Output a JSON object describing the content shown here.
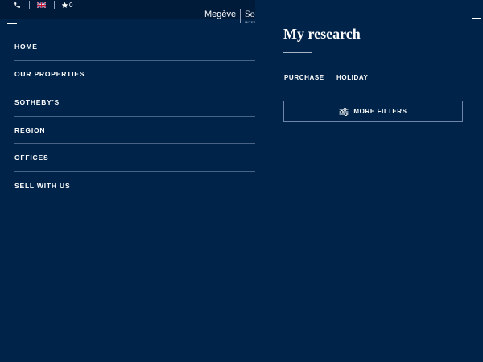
{
  "topbar": {
    "phone_icon": "phone-icon",
    "flag_icon": "uk-flag-icon",
    "star_icon": "star-icon",
    "favorites_count": "0"
  },
  "brand": {
    "town": "Megève",
    "name": "So",
    "sub": "INTER"
  },
  "menu": {
    "items": [
      {
        "label": "HOME"
      },
      {
        "label": "OUR PROPERTIES"
      },
      {
        "label": "SOTHEBY'S"
      },
      {
        "label": "REGION"
      },
      {
        "label": "OFFICES"
      },
      {
        "label": "SELL WITH US"
      }
    ]
  },
  "research": {
    "title": "My research",
    "tabs": [
      {
        "label": "PURCHASE"
      },
      {
        "label": "HOLIDAY"
      }
    ],
    "filters_button": {
      "label": "MORE FILTERS",
      "icon": "sliders-icon"
    }
  },
  "colors": {
    "background": "#002349",
    "topbar": "#001b3a",
    "divider": "#4a6285",
    "text": "#ffffff"
  }
}
